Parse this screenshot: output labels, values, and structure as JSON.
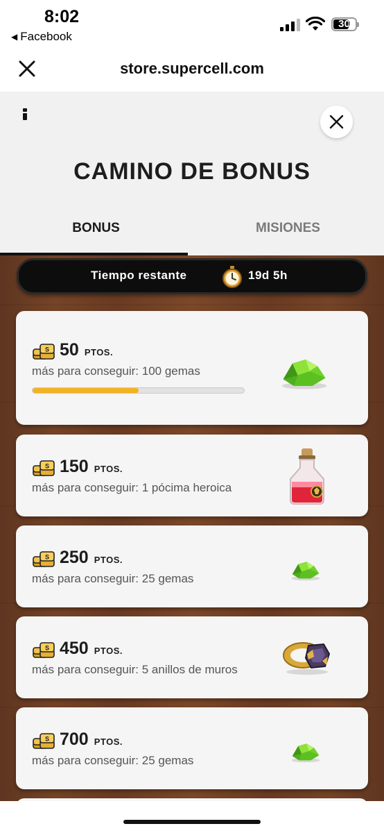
{
  "status_bar": {
    "time": "8:02",
    "back_app": "Facebook",
    "battery_level": "30"
  },
  "browser": {
    "url": "store.supercell.com",
    "close_icon": "close-icon"
  },
  "modal": {
    "title": "CAMINO DE BONUS",
    "info_icon": "info-icon",
    "close_icon": "close-icon",
    "tabs": [
      {
        "label": "BONUS",
        "active": true
      },
      {
        "label": "MISIONES",
        "active": false
      }
    ]
  },
  "timer": {
    "label": "Tiempo restante",
    "value": "19d 5h",
    "icon": "stopwatch-icon"
  },
  "rewards": [
    {
      "points": "50",
      "unit": "PTOS.",
      "description": "más para conseguir: 100 gemas",
      "progress": 0.5,
      "reward_icon": "gems-icon"
    },
    {
      "points": "150",
      "unit": "PTOS.",
      "description": "más para conseguir: 1 pócima heroica",
      "reward_icon": "hero-potion-icon"
    },
    {
      "points": "250",
      "unit": "PTOS.",
      "description": "más para conseguir: 25 gemas",
      "reward_icon": "gems-icon"
    },
    {
      "points": "450",
      "unit": "PTOS.",
      "description": "más para conseguir: 5 anillos de muros",
      "reward_icon": "wall-ring-icon"
    },
    {
      "points": "700",
      "unit": "PTOS.",
      "description": "más para conseguir: 25 gemas",
      "reward_icon": "gems-icon"
    }
  ],
  "colors": {
    "accent": "#f5b21d",
    "panel_bg": "#f1f1f1",
    "wood": "#6e3d24",
    "card_bg": "#f5f5f5"
  }
}
